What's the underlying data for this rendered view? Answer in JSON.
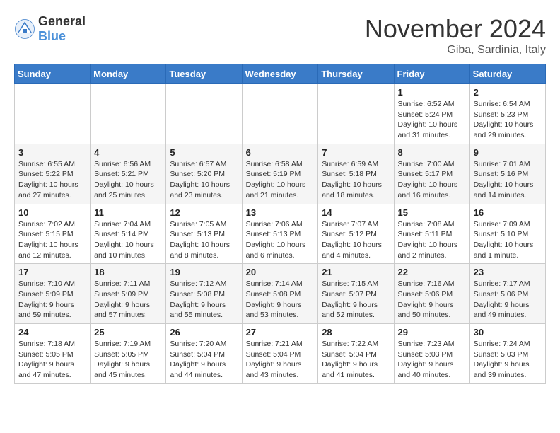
{
  "logo": {
    "general": "General",
    "blue": "Blue"
  },
  "header": {
    "month": "November 2024",
    "location": "Giba, Sardinia, Italy"
  },
  "weekdays": [
    "Sunday",
    "Monday",
    "Tuesday",
    "Wednesday",
    "Thursday",
    "Friday",
    "Saturday"
  ],
  "weeks": [
    [
      {
        "day": "",
        "info": ""
      },
      {
        "day": "",
        "info": ""
      },
      {
        "day": "",
        "info": ""
      },
      {
        "day": "",
        "info": ""
      },
      {
        "day": "",
        "info": ""
      },
      {
        "day": "1",
        "info": "Sunrise: 6:52 AM\nSunset: 5:24 PM\nDaylight: 10 hours and 31 minutes."
      },
      {
        "day": "2",
        "info": "Sunrise: 6:54 AM\nSunset: 5:23 PM\nDaylight: 10 hours and 29 minutes."
      }
    ],
    [
      {
        "day": "3",
        "info": "Sunrise: 6:55 AM\nSunset: 5:22 PM\nDaylight: 10 hours and 27 minutes."
      },
      {
        "day": "4",
        "info": "Sunrise: 6:56 AM\nSunset: 5:21 PM\nDaylight: 10 hours and 25 minutes."
      },
      {
        "day": "5",
        "info": "Sunrise: 6:57 AM\nSunset: 5:20 PM\nDaylight: 10 hours and 23 minutes."
      },
      {
        "day": "6",
        "info": "Sunrise: 6:58 AM\nSunset: 5:19 PM\nDaylight: 10 hours and 21 minutes."
      },
      {
        "day": "7",
        "info": "Sunrise: 6:59 AM\nSunset: 5:18 PM\nDaylight: 10 hours and 18 minutes."
      },
      {
        "day": "8",
        "info": "Sunrise: 7:00 AM\nSunset: 5:17 PM\nDaylight: 10 hours and 16 minutes."
      },
      {
        "day": "9",
        "info": "Sunrise: 7:01 AM\nSunset: 5:16 PM\nDaylight: 10 hours and 14 minutes."
      }
    ],
    [
      {
        "day": "10",
        "info": "Sunrise: 7:02 AM\nSunset: 5:15 PM\nDaylight: 10 hours and 12 minutes."
      },
      {
        "day": "11",
        "info": "Sunrise: 7:04 AM\nSunset: 5:14 PM\nDaylight: 10 hours and 10 minutes."
      },
      {
        "day": "12",
        "info": "Sunrise: 7:05 AM\nSunset: 5:13 PM\nDaylight: 10 hours and 8 minutes."
      },
      {
        "day": "13",
        "info": "Sunrise: 7:06 AM\nSunset: 5:13 PM\nDaylight: 10 hours and 6 minutes."
      },
      {
        "day": "14",
        "info": "Sunrise: 7:07 AM\nSunset: 5:12 PM\nDaylight: 10 hours and 4 minutes."
      },
      {
        "day": "15",
        "info": "Sunrise: 7:08 AM\nSunset: 5:11 PM\nDaylight: 10 hours and 2 minutes."
      },
      {
        "day": "16",
        "info": "Sunrise: 7:09 AM\nSunset: 5:10 PM\nDaylight: 10 hours and 1 minute."
      }
    ],
    [
      {
        "day": "17",
        "info": "Sunrise: 7:10 AM\nSunset: 5:09 PM\nDaylight: 9 hours and 59 minutes."
      },
      {
        "day": "18",
        "info": "Sunrise: 7:11 AM\nSunset: 5:09 PM\nDaylight: 9 hours and 57 minutes."
      },
      {
        "day": "19",
        "info": "Sunrise: 7:12 AM\nSunset: 5:08 PM\nDaylight: 9 hours and 55 minutes."
      },
      {
        "day": "20",
        "info": "Sunrise: 7:14 AM\nSunset: 5:08 PM\nDaylight: 9 hours and 53 minutes."
      },
      {
        "day": "21",
        "info": "Sunrise: 7:15 AM\nSunset: 5:07 PM\nDaylight: 9 hours and 52 minutes."
      },
      {
        "day": "22",
        "info": "Sunrise: 7:16 AM\nSunset: 5:06 PM\nDaylight: 9 hours and 50 minutes."
      },
      {
        "day": "23",
        "info": "Sunrise: 7:17 AM\nSunset: 5:06 PM\nDaylight: 9 hours and 49 minutes."
      }
    ],
    [
      {
        "day": "24",
        "info": "Sunrise: 7:18 AM\nSunset: 5:05 PM\nDaylight: 9 hours and 47 minutes."
      },
      {
        "day": "25",
        "info": "Sunrise: 7:19 AM\nSunset: 5:05 PM\nDaylight: 9 hours and 45 minutes."
      },
      {
        "day": "26",
        "info": "Sunrise: 7:20 AM\nSunset: 5:04 PM\nDaylight: 9 hours and 44 minutes."
      },
      {
        "day": "27",
        "info": "Sunrise: 7:21 AM\nSunset: 5:04 PM\nDaylight: 9 hours and 43 minutes."
      },
      {
        "day": "28",
        "info": "Sunrise: 7:22 AM\nSunset: 5:04 PM\nDaylight: 9 hours and 41 minutes."
      },
      {
        "day": "29",
        "info": "Sunrise: 7:23 AM\nSunset: 5:03 PM\nDaylight: 9 hours and 40 minutes."
      },
      {
        "day": "30",
        "info": "Sunrise: 7:24 AM\nSunset: 5:03 PM\nDaylight: 9 hours and 39 minutes."
      }
    ]
  ]
}
